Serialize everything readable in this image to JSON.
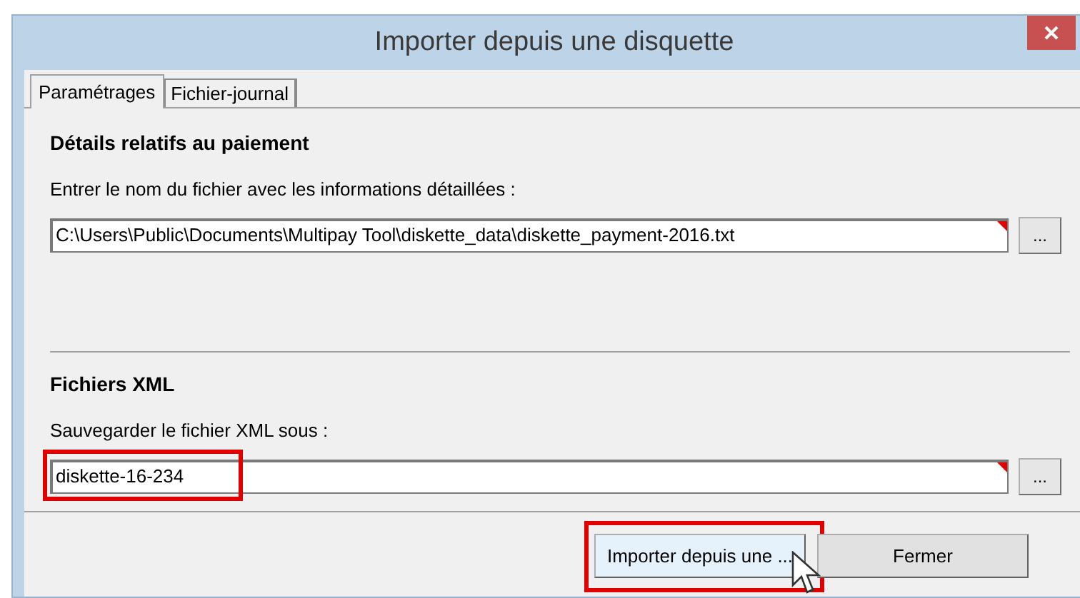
{
  "window": {
    "title": "Importer depuis une disquette"
  },
  "tabs": [
    {
      "label": "Paramétrages",
      "selected": true
    },
    {
      "label": "Fichier-journal",
      "selected": false
    }
  ],
  "sections": [
    {
      "heading": "Détails relatifs au paiement",
      "label": "Entrer le nom du fichier avec les informations détaillées :",
      "value": "C:\\Users\\Public\\Documents\\Multipay Tool\\diskette_data\\diskette_payment-2016.txt",
      "required": true,
      "browse": "...",
      "highlighted": false
    },
    {
      "heading": "Fichiers XML",
      "label": "Sauvegarder le fichier XML sous :",
      "value": "diskette-16-234",
      "required": true,
      "browse": "...",
      "highlighted": true
    }
  ],
  "buttons": [
    {
      "label": "Importer depuis une ...",
      "highlighted": true,
      "hovered": true
    },
    {
      "label": "Fermer",
      "highlighted": false,
      "hovered": false
    }
  ]
}
